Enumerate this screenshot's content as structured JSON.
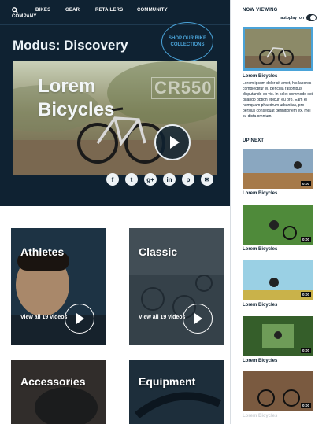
{
  "nav": {
    "items": [
      "BIKES",
      "GEAR",
      "RETAILERS",
      "COMMUNITY"
    ],
    "company": "COMPANY"
  },
  "hero": {
    "title": "Modus: Discovery",
    "shop_link": "SHOP OUR BIKE COLLECTIONS",
    "video_title_line1": "Lorem",
    "video_title_line2": "Bicycles",
    "video_brand_text": "CR550"
  },
  "social": [
    {
      "icon": "facebook-icon",
      "glyph": "f"
    },
    {
      "icon": "twitter-icon",
      "glyph": "t"
    },
    {
      "icon": "google-plus-icon",
      "glyph": "g+"
    },
    {
      "icon": "linkedin-icon",
      "glyph": "in"
    },
    {
      "icon": "pinterest-icon",
      "glyph": "p"
    },
    {
      "icon": "email-icon",
      "glyph": "✉"
    }
  ],
  "cards": [
    {
      "title": "Athletes",
      "link": "View all 19 videos"
    },
    {
      "title": "Classic",
      "link": "View all 19 videos"
    },
    {
      "title": "Accessories",
      "link": ""
    },
    {
      "title": "Equipment",
      "link": ""
    }
  ],
  "sidebar": {
    "now_viewing": "NOW VIEWING",
    "autoplay_label": "autoplay",
    "autoplay_state": "on",
    "now_title": "Lorem Bicycles",
    "now_description": "Lorem ipsum dolor sit amet, his labores complectitur ei, pericula rationibus disputando ex vix. In solet commodo est, quando option epicuri eu pro. Eam ei numquam phaedrum urbanitas, pro persius consequat definitionem ex, mel cu dicta omnium.",
    "up_next": "UP NEXT",
    "up_next_items": [
      {
        "title": "Lorem Bicycles",
        "duration": "0:00"
      },
      {
        "title": "Lorem Bicycles",
        "duration": "0:00"
      },
      {
        "title": "Lorem Bicycles",
        "duration": "0:00"
      },
      {
        "title": "Lorem Bicycles",
        "duration": "0:00"
      },
      {
        "title": "Lorem Bicycles",
        "duration": "0:00"
      }
    ]
  },
  "colors": {
    "navy": "#0f2232",
    "accent": "#4aa3d8"
  }
}
